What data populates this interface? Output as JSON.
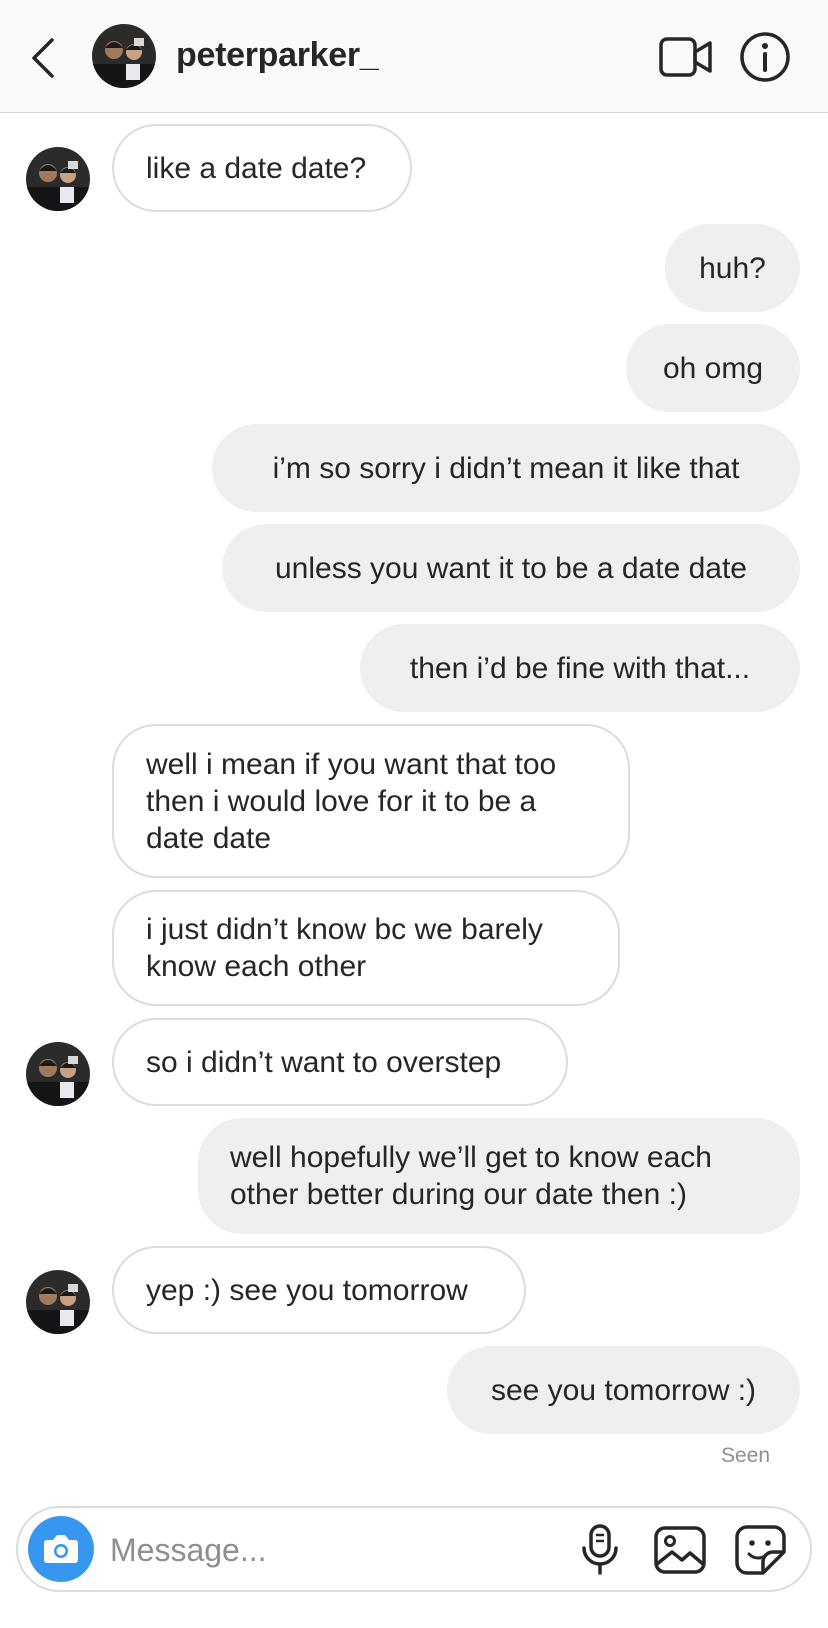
{
  "header": {
    "username": "peterparker_",
    "back_icon": "chevron-left-icon",
    "video_icon": "video-camera-icon",
    "info_icon": "info-icon"
  },
  "messages": [
    {
      "from": "them",
      "text": "like a date date?"
    },
    {
      "from": "me",
      "text": "huh?"
    },
    {
      "from": "me",
      "text": "oh omg"
    },
    {
      "from": "me",
      "text": "i’m so sorry i didn’t mean it like that"
    },
    {
      "from": "me",
      "text": "unless you want it to be a date date"
    },
    {
      "from": "me",
      "text": "then i’d be fine with that..."
    },
    {
      "from": "them",
      "text": "well i mean if you want that too then i would love for it to be a date date"
    },
    {
      "from": "them",
      "text": "i just didn’t know bc we barely know each other"
    },
    {
      "from": "them",
      "text": "so i didn’t want to overstep"
    },
    {
      "from": "me",
      "text": "well hopefully we’ll get to know each other better during our date then :)"
    },
    {
      "from": "them",
      "text": "yep :) see you tomorrow"
    },
    {
      "from": "me",
      "text": "see you tomorrow :)"
    }
  ],
  "status": {
    "seen": "Seen"
  },
  "composer": {
    "placeholder": "Message...",
    "camera_icon": "camera-icon",
    "mic_icon": "microphone-icon",
    "gallery_icon": "image-gallery-icon",
    "sticker_icon": "sticker-icon"
  },
  "colors": {
    "accent": "#3797f0",
    "outgoing_bubble": "#efefef",
    "incoming_border": "#dbdbdb",
    "text": "#262626",
    "muted": "#8e8e8e"
  }
}
